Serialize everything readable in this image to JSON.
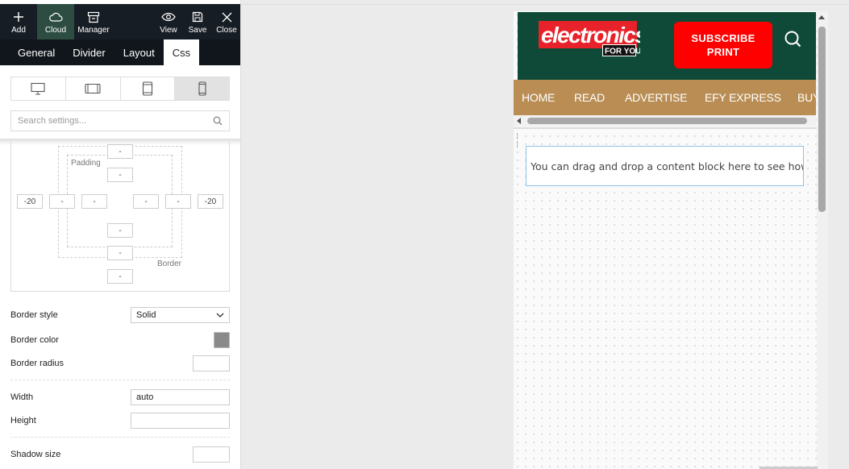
{
  "toolbar": {
    "add": "Add",
    "cloud": "Cloud",
    "manager": "Manager",
    "view": "View",
    "save": "Save",
    "close": "Close"
  },
  "tabs": [
    "General",
    "Divider",
    "Layout",
    "Css"
  ],
  "search": {
    "placeholder": "Search settings..."
  },
  "box_model": {
    "padding_label": "Padding",
    "border_label": "Border",
    "margin_top": "-",
    "border_top": "-",
    "padding_top": "-",
    "margin_left": "-20",
    "border_left": "-",
    "padding_left": "-",
    "padding_right": "-",
    "border_right": "-",
    "margin_right": "-20",
    "padding_bottom": "-",
    "border_bottom": "-",
    "margin_bottom": "-"
  },
  "settings": {
    "border_style_label": "Border style",
    "border_style_value": "Solid",
    "border_color_label": "Border color",
    "border_color_value": "#8a8a8a",
    "border_radius_label": "Border radius",
    "width_label": "Width",
    "width_value": "auto",
    "height_label": "Height",
    "shadow_size_label": "Shadow size"
  },
  "site": {
    "logo_main": "electronics",
    "logo_sub": "FOR YOU",
    "subscribe_line1": "SUBSCRIBE",
    "subscribe_line2": "PRINT",
    "header_color": "#0e4a37",
    "nav_color": "#b98d54",
    "nav": [
      "HOME",
      "READ",
      "ADVERTISE",
      "EFY EXPRESS",
      "BUY"
    ],
    "dropzone_text": "You can drag and drop a content block here to see how"
  }
}
